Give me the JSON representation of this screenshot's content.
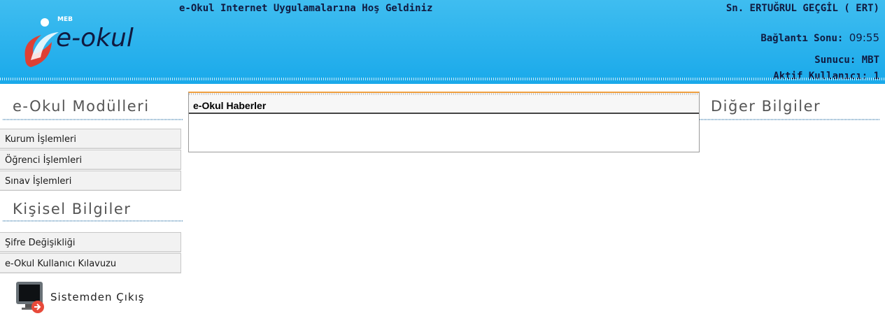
{
  "header": {
    "logo_badge": "MEB",
    "logo_text": "e-okul",
    "welcome": "e-Okul Internet Uygulamalarına Hoş Geldiniz",
    "user_name": "Sn. ERTUĞRUL GEÇGİL ( ERT)",
    "session_end_label": "Bağlantı Sonu:",
    "session_end_time": "09:55",
    "server": "Sunucu: MBT",
    "active_users": "Aktif Kullanıcı: 1"
  },
  "modules": {
    "title": "e-Okul Modülleri",
    "items": [
      {
        "label": "Kurum İşlemleri"
      },
      {
        "label": "Öğrenci İşlemleri"
      },
      {
        "label": "Sınav İşlemleri"
      }
    ]
  },
  "personal": {
    "title": "Kişisel Bilgiler",
    "items": [
      {
        "label": "Şifre Değişikliği"
      },
      {
        "label": "e-Okul Kullanıcı Kılavuzu"
      }
    ]
  },
  "news": {
    "title": "e-Okul Haberler"
  },
  "other": {
    "title": "Diğer Bilgiler"
  },
  "logout": {
    "label": "Sistemden Çıkış",
    "icon": "monitor-logout-icon"
  },
  "colors": {
    "header_bg": "#1aa9ea",
    "header_text": "#101a40",
    "news_top_border": "#f0a040",
    "section_title": "#555555"
  }
}
